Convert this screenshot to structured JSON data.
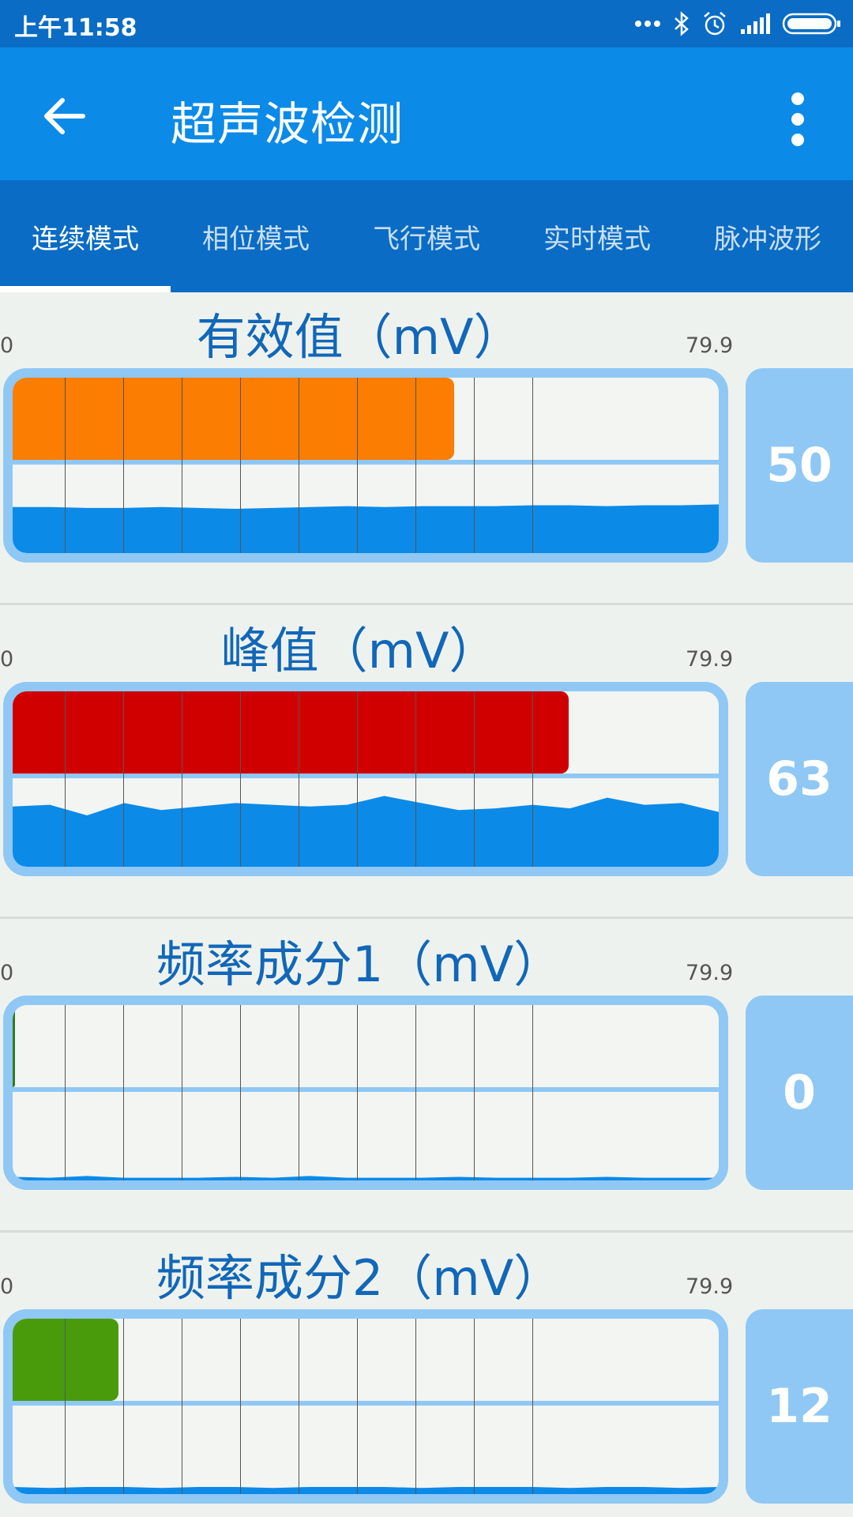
{
  "status_bar": {
    "time": "上午11:58",
    "icons": [
      "more-dots-icon",
      "bluetooth-icon",
      "alarm-icon",
      "signal-icon",
      "battery-icon"
    ]
  },
  "toolbar": {
    "title": "超声波检测",
    "back_icon": "arrow-left-icon",
    "menu_icon": "more-vertical-icon"
  },
  "tabs": [
    {
      "label": "连续模式",
      "active": true
    },
    {
      "label": "相位模式",
      "active": false
    },
    {
      "label": "飞行模式",
      "active": false
    },
    {
      "label": "实时模式",
      "active": false
    },
    {
      "label": "脉冲波形",
      "active": false
    }
  ],
  "panels": [
    {
      "title": "有效值（mV）",
      "min": "0",
      "max": "79.9",
      "value": "50",
      "level": 0.625,
      "bar_color": "#fb7d02",
      "wave": [
        0.52,
        0.52,
        0.51,
        0.51,
        0.52,
        0.51,
        0.5,
        0.51,
        0.52,
        0.53,
        0.52,
        0.53,
        0.53,
        0.53,
        0.54,
        0.54,
        0.53,
        0.54,
        0.54,
        0.55
      ]
    },
    {
      "title": "峰值（mV）",
      "min": "0",
      "max": "79.9",
      "value": "63",
      "level": 0.788,
      "bar_color": "#d10000",
      "wave": [
        0.68,
        0.7,
        0.58,
        0.72,
        0.64,
        0.68,
        0.72,
        0.7,
        0.68,
        0.7,
        0.8,
        0.72,
        0.64,
        0.66,
        0.7,
        0.66,
        0.78,
        0.7,
        0.72,
        0.62
      ]
    },
    {
      "title": "频率成分1（mV）",
      "min": "0",
      "max": "79.9",
      "value": "0",
      "level": 0.0,
      "bar_color": "#2e7d1e",
      "wave": [
        0.04,
        0.03,
        0.05,
        0.03,
        0.03,
        0.03,
        0.04,
        0.03,
        0.05,
        0.03,
        0.03,
        0.03,
        0.04,
        0.03,
        0.03,
        0.03,
        0.04,
        0.03,
        0.03,
        0.03
      ]
    },
    {
      "title": "频率成分2（mV）",
      "min": "0",
      "max": "79.9",
      "value": "12",
      "level": 0.15,
      "bar_color": "#4a9b0c",
      "wave": [
        0.08,
        0.07,
        0.08,
        0.08,
        0.07,
        0.08,
        0.08,
        0.07,
        0.08,
        0.08,
        0.08,
        0.07,
        0.08,
        0.08,
        0.08,
        0.07,
        0.08,
        0.08,
        0.07,
        0.08
      ]
    }
  ],
  "colors": {
    "wave": "#0b8ae8",
    "gauge_border": "#8fc8f4"
  }
}
